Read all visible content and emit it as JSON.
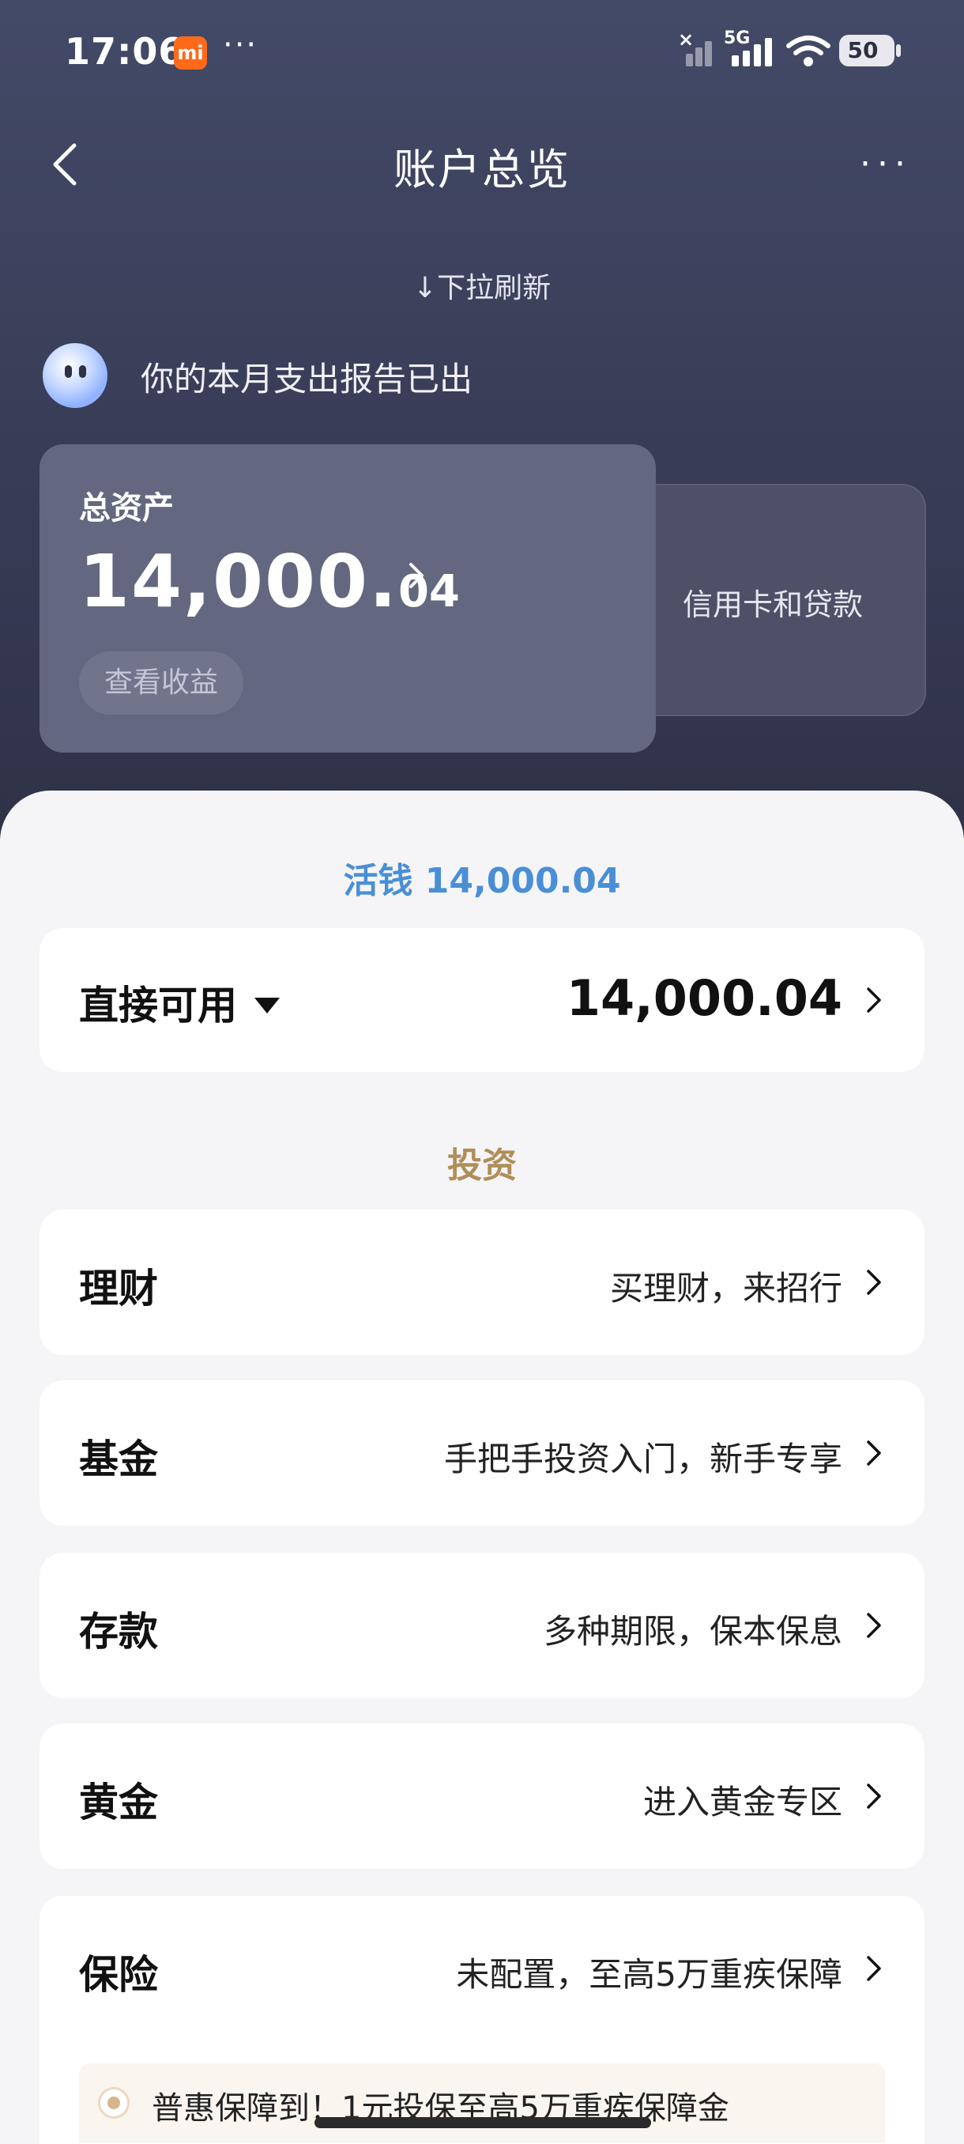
{
  "status_bar": {
    "time": "17:06",
    "app_badge": "mi",
    "dots": "···",
    "network": "5G",
    "no_signal_mark": "×",
    "battery": "50"
  },
  "header": {
    "title": "账户总览",
    "back_icon": "chevron-left-icon",
    "more_icon": "more-dots-icon",
    "more": "···"
  },
  "refresh_hint": "↓下拉刷新",
  "notice": {
    "text": "你的本月支出报告已出"
  },
  "asset_card": {
    "label": "总资产",
    "amount_int": "14,000.",
    "amount_dec": "04",
    "button": "查看收益"
  },
  "side_card": {
    "label": "信用卡和贷款"
  },
  "liquid": {
    "title": "活钱 14,000.04",
    "row_label": "直接可用",
    "row_value": "14,000.04"
  },
  "invest": {
    "title": "投资",
    "rows": [
      {
        "label": "理财",
        "value": "买理财，来招行"
      },
      {
        "label": "基金",
        "value": "手把手投资入门，新手专享"
      },
      {
        "label": "存款",
        "value": "多种期限，保本保息"
      },
      {
        "label": "黄金",
        "value": "进入黄金专区"
      },
      {
        "label": "保险",
        "value": "未配置，至高5万重疾保障"
      }
    ],
    "promo": "普惠保障到！1元投保至高5万重疾保障金"
  },
  "colors": {
    "header_bg": "#3a3f59",
    "accent_blue": "#4a8fd6",
    "accent_gold": "#b08e58"
  }
}
